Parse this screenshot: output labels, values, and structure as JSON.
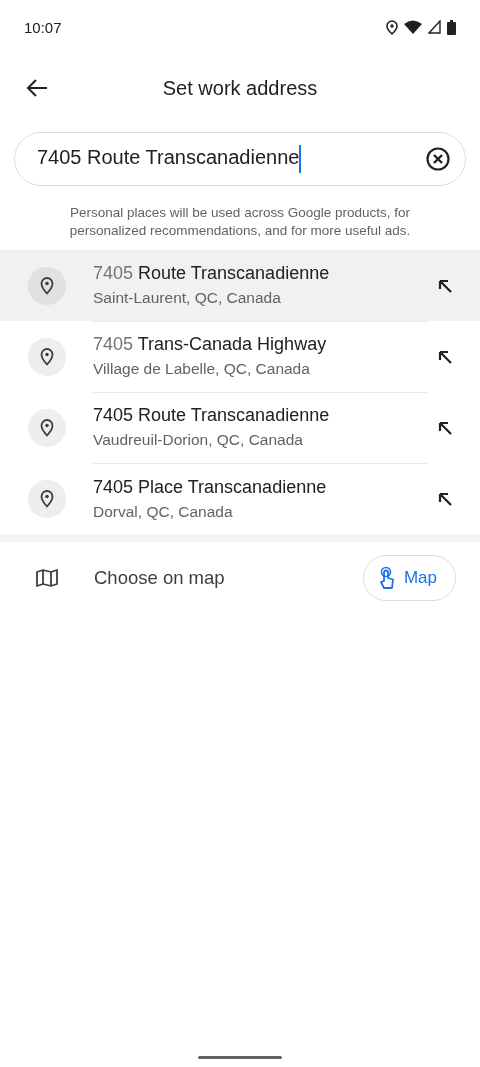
{
  "status_bar": {
    "time": "10:07"
  },
  "app_bar": {
    "title": "Set work address"
  },
  "search": {
    "value": "7405 Route Transcanadienne"
  },
  "notice": "Personal places will be used across Google products, for personalized recommendations, and for more useful ads.",
  "suggestions": [
    {
      "number": "7405",
      "number_dimmed": true,
      "street": "Route Transcanadienne",
      "place": "Saint-Laurent, QC, Canada",
      "selected": true
    },
    {
      "number": "7405",
      "number_dimmed": true,
      "street": "Trans-Canada Highway",
      "place": "Village de Labelle, QC, Canada",
      "selected": false
    },
    {
      "number": "7405",
      "number_dimmed": false,
      "street": "Route Transcanadienne",
      "place": "Vaudreuil-Dorion, QC, Canada",
      "selected": false
    },
    {
      "number": "7405",
      "number_dimmed": false,
      "street": "Place Transcanadienne",
      "place": "Dorval, QC, Canada",
      "selected": false
    }
  ],
  "choose_on_map": {
    "label": "Choose on map",
    "button": "Map"
  }
}
